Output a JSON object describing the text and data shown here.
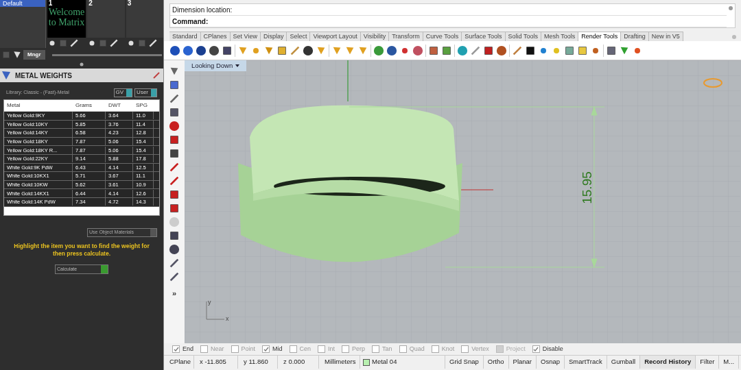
{
  "library_panel": {
    "items": [
      {
        "label": "Default",
        "selected": true
      }
    ],
    "slots": [
      {
        "number": "1",
        "thumbnail_text": "Welcome to Matrix"
      },
      {
        "number": "2"
      },
      {
        "number": "3"
      }
    ],
    "manager_button": "Mngr"
  },
  "metal_weights": {
    "title": "METAL WEIGHTS",
    "library": "Library: Classic - (Fast)-Metal",
    "toggles": [
      {
        "label": "GV",
        "on": true
      },
      {
        "label": "User",
        "on": true
      }
    ],
    "table": {
      "columns": [
        "Metal",
        "Grams",
        "DWT",
        "SPG"
      ],
      "rows": [
        [
          "Yellow Gold:9KY",
          "5.66",
          "3.64",
          "11.0"
        ],
        [
          "Yellow Gold:10KY",
          "5.85",
          "3.76",
          "11.4"
        ],
        [
          "Yellow Gold:14KY",
          "6.58",
          "4.23",
          "12.8"
        ],
        [
          "Yellow Gold:18KY",
          "7.87",
          "5.06",
          "15.4"
        ],
        [
          "Yellow Gold:18KY R...",
          "7.87",
          "5.06",
          "15.4"
        ],
        [
          "Yellow Gold:22KY",
          "9.14",
          "5.88",
          "17.8"
        ],
        [
          "White Gold:9K PdW",
          "6.43",
          "4.14",
          "12.5"
        ],
        [
          "White Gold:10KX1",
          "5.71",
          "3.67",
          "11.1"
        ],
        [
          "White Gold:10KW",
          "5.62",
          "3.61",
          "10.9"
        ],
        [
          "White Gold:14KX1",
          "6.44",
          "4.14",
          "12.6"
        ],
        [
          "White Gold:14K PdW",
          "7.34",
          "4.72",
          "14.3"
        ]
      ]
    },
    "use_object_materials": {
      "label": "Use Object Materials",
      "checked": false
    },
    "hint": "Highlight the item you want to find the weight for then press calculate.",
    "calculate": "Calculate"
  },
  "command": {
    "lines": [
      "Dimension location:",
      "Command:"
    ]
  },
  "tabs": [
    {
      "label": "Standard",
      "selected": false
    },
    {
      "label": "CPlanes",
      "selected": false
    },
    {
      "label": "Set View",
      "selected": false
    },
    {
      "label": "Display",
      "selected": false
    },
    {
      "label": "Select",
      "selected": false
    },
    {
      "label": "Viewport Layout",
      "selected": false
    },
    {
      "label": "Visibility",
      "selected": false
    },
    {
      "label": "Transform",
      "selected": false
    },
    {
      "label": "Curve Tools",
      "selected": false
    },
    {
      "label": "Surface Tools",
      "selected": false
    },
    {
      "label": "Solid Tools",
      "selected": false
    },
    {
      "label": "Mesh Tools",
      "selected": false
    },
    {
      "label": "Render Tools",
      "selected": true
    },
    {
      "label": "Drafting",
      "selected": false
    },
    {
      "label": "New in V5",
      "selected": false
    }
  ],
  "side_toolbar": {
    "more": "»"
  },
  "viewport": {
    "label": "Looking Down",
    "dimension": "15.95",
    "axis_labels": [
      "y",
      "x"
    ]
  },
  "osnaps": [
    {
      "label": "End",
      "checked": true,
      "disabled": false
    },
    {
      "label": "Near",
      "checked": false,
      "disabled": false
    },
    {
      "label": "Point",
      "checked": false,
      "disabled": false
    },
    {
      "label": "Mid",
      "checked": true,
      "disabled": false
    },
    {
      "label": "Cen",
      "checked": false,
      "disabled": false
    },
    {
      "label": "Int",
      "checked": false,
      "disabled": false
    },
    {
      "label": "Perp",
      "checked": false,
      "disabled": false
    },
    {
      "label": "Tan",
      "checked": false,
      "disabled": false
    },
    {
      "label": "Quad",
      "checked": false,
      "disabled": false
    },
    {
      "label": "Knot",
      "checked": false,
      "disabled": false
    },
    {
      "label": "Vertex",
      "checked": false,
      "disabled": false
    },
    {
      "label": "Project",
      "checked": false,
      "disabled": true
    },
    {
      "label": "Disable",
      "checked": true,
      "disabled": false
    }
  ],
  "status_bar": {
    "cells": [
      "CPlane",
      "x -11.805",
      "y 11.860",
      "z 0.000",
      "Millimeters"
    ],
    "layer": {
      "name": "Metal 04",
      "color": "#b8f0b0"
    },
    "panes": [
      {
        "label": "Grid Snap",
        "on": false
      },
      {
        "label": "Ortho",
        "on": false
      },
      {
        "label": "Planar",
        "on": false
      },
      {
        "label": "Osnap",
        "on": false
      },
      {
        "label": "SmartTrack",
        "on": false
      },
      {
        "label": "Gumball",
        "on": false
      },
      {
        "label": "Record History",
        "on": true
      },
      {
        "label": "Filter",
        "on": false
      },
      {
        "label": "M...",
        "on": false
      }
    ]
  }
}
